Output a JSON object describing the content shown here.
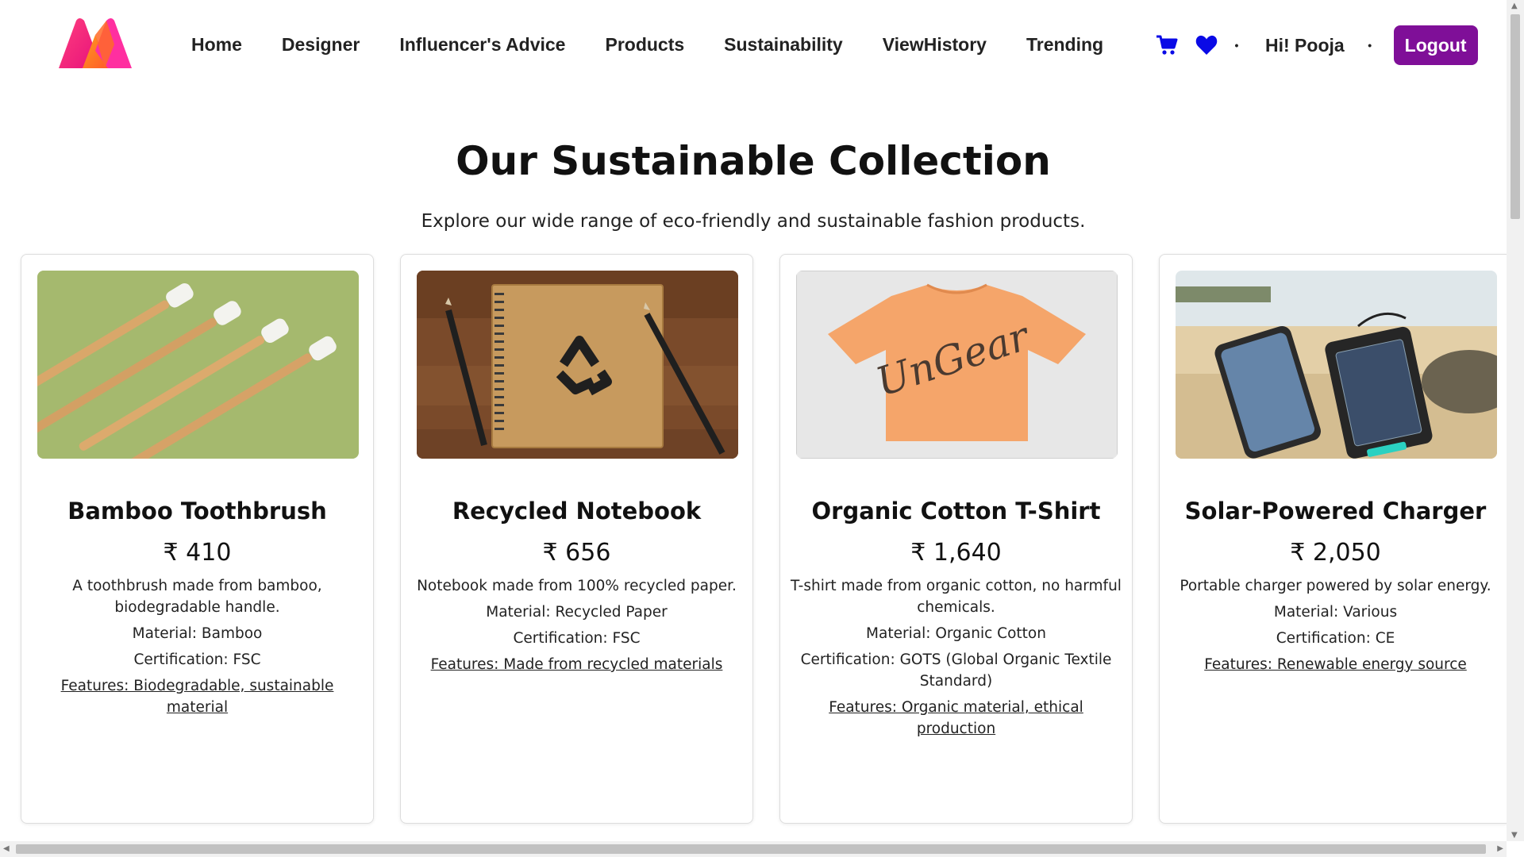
{
  "header": {
    "nav": [
      "Home",
      "Designer",
      "Influencer's Advice",
      "Products",
      "Sustainability",
      "ViewHistory",
      "Trending"
    ],
    "greeting": "Hi! Pooja",
    "logout_label": "Logout",
    "icons": [
      "cart-icon",
      "heart-icon"
    ],
    "accent_color": "#7f0f98",
    "icon_color": "#0a0ae6"
  },
  "hero": {
    "title": "Our Sustainable Collection",
    "subtitle": "Explore our wide range of eco-friendly and sustainable fashion products."
  },
  "products": [
    {
      "name": "Bamboo Toothbrush",
      "price": "₹ 410",
      "description": "A toothbrush made from bamboo, biodegradable handle.",
      "material": "Material: Bamboo",
      "certification": "Certification: FSC",
      "features": "Features: Biodegradable, sustainable material"
    },
    {
      "name": "Recycled Notebook",
      "price": "₹ 656",
      "description": "Notebook made from 100% recycled paper.",
      "material": "Material: Recycled Paper",
      "certification": "Certification: FSC",
      "features": "Features: Made from recycled materials"
    },
    {
      "name": "Organic Cotton T-Shirt",
      "price": "₹ 1,640",
      "description": "T-shirt made from organic cotton, no harmful chemicals.",
      "material": "Material: Organic Cotton",
      "certification": "Certification: GOTS (Global Organic Textile Standard)",
      "features": "Features: Organic material, ethical production",
      "image_text": "UnGear"
    },
    {
      "name": "Solar-Powered Charger",
      "price": "₹ 2,050",
      "description": "Portable charger powered by solar energy.",
      "material": "Material: Various",
      "certification": "Certification: CE",
      "features": "Features: Renewable energy source"
    }
  ]
}
